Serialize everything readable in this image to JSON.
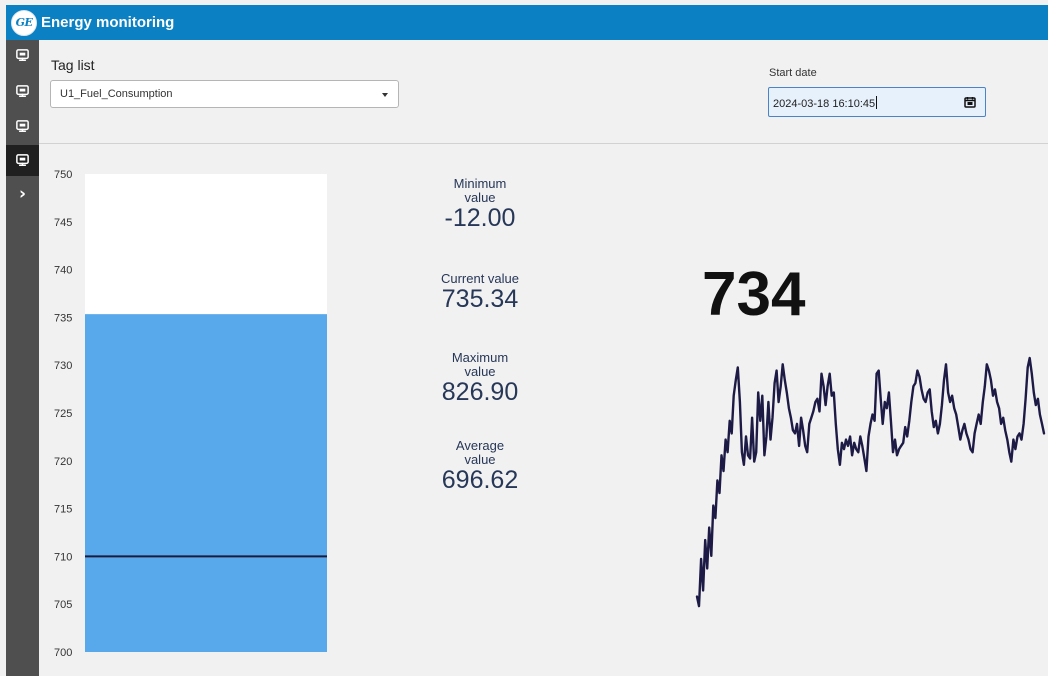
{
  "app": {
    "logo_text": "GE",
    "title": "Energy monitoring"
  },
  "controls": {
    "tag_list": {
      "label": "Tag list",
      "selected": "U1_Fuel_Consumption"
    },
    "start_date": {
      "label": "Start date",
      "value": "2024-03-18 16:10:45"
    }
  },
  "stats": {
    "minimum": {
      "label_line1": "Minimum",
      "label_line2": "value",
      "value": "-12.00"
    },
    "current": {
      "label": "Current value",
      "value": "735.34"
    },
    "maximum": {
      "label_line1": "Maximum",
      "label_line2": "value",
      "value": "826.90"
    },
    "average": {
      "label_line1": "Average",
      "label_line2": "value",
      "value": "696.62"
    }
  },
  "big_value": "734",
  "chart_data": [
    {
      "type": "bar",
      "categories": [
        ""
      ],
      "values": [
        735.34
      ],
      "reference_line": 710,
      "ylim": [
        700,
        750
      ],
      "yticks": [
        750,
        745,
        740,
        735,
        730,
        725,
        720,
        715,
        710,
        705,
        700
      ],
      "grid": false,
      "legend": "none"
    },
    {
      "type": "line",
      "series": [
        {
          "values": [
            0.24,
            0.21,
            0.36,
            0.26,
            0.42,
            0.33,
            0.46,
            0.37,
            0.53,
            0.49,
            0.61,
            0.57,
            0.69,
            0.64,
            0.74,
            0.7,
            0.8,
            0.76,
            0.88,
            0.93,
            0.97,
            0.86,
            0.7,
            0.66,
            0.75,
            0.69,
            0.68,
            0.81,
            0.67,
            0.7,
            0.89,
            0.8,
            0.88,
            0.69,
            0.75,
            0.86,
            0.74,
            0.81,
            0.92,
            0.96,
            0.86,
            0.91,
            0.98,
            0.93,
            0.89,
            0.84,
            0.81,
            0.77,
            0.76,
            0.79,
            0.72,
            0.81,
            0.77,
            0.72,
            0.7,
            0.79,
            0.81,
            0.83,
            0.86,
            0.87,
            0.83,
            0.95,
            0.91,
            0.85,
            0.91,
            0.95,
            0.88,
            0.89,
            0.79,
            0.71,
            0.66,
            0.73,
            0.71,
            0.74,
            0.72,
            0.75,
            0.69,
            0.73,
            0.71,
            0.7,
            0.75,
            0.72,
            0.68,
            0.64,
            0.75,
            0.79,
            0.82,
            0.8,
            0.95,
            0.96,
            0.87,
            0.79,
            0.86,
            0.84,
            0.89,
            0.8,
            0.7,
            0.74,
            0.69,
            0.71,
            0.72,
            0.73,
            0.78,
            0.75,
            0.8,
            0.86,
            0.91,
            0.92,
            0.96,
            0.94,
            0.9,
            0.87,
            0.86,
            0.89,
            0.9,
            0.83,
            0.78,
            0.8,
            0.76,
            0.79,
            0.85,
            0.93,
            0.98,
            0.89,
            0.86,
            0.88,
            0.84,
            0.82,
            0.78,
            0.74,
            0.77,
            0.79,
            0.76,
            0.74,
            0.71,
            0.7,
            0.76,
            0.79,
            0.82,
            0.79,
            0.86,
            0.91,
            0.98,
            0.96,
            0.93,
            0.88,
            0.9,
            0.86,
            0.84,
            0.79,
            0.81,
            0.77,
            0.74,
            0.7,
            0.67,
            0.74,
            0.71,
            0.75,
            0.76,
            0.74,
            0.79,
            0.87,
            0.97,
            1.0,
            0.95,
            0.89,
            0.85,
            0.87,
            0.82,
            0.79,
            0.76
          ]
        }
      ],
      "grid": false,
      "legend": "none"
    }
  ]
}
